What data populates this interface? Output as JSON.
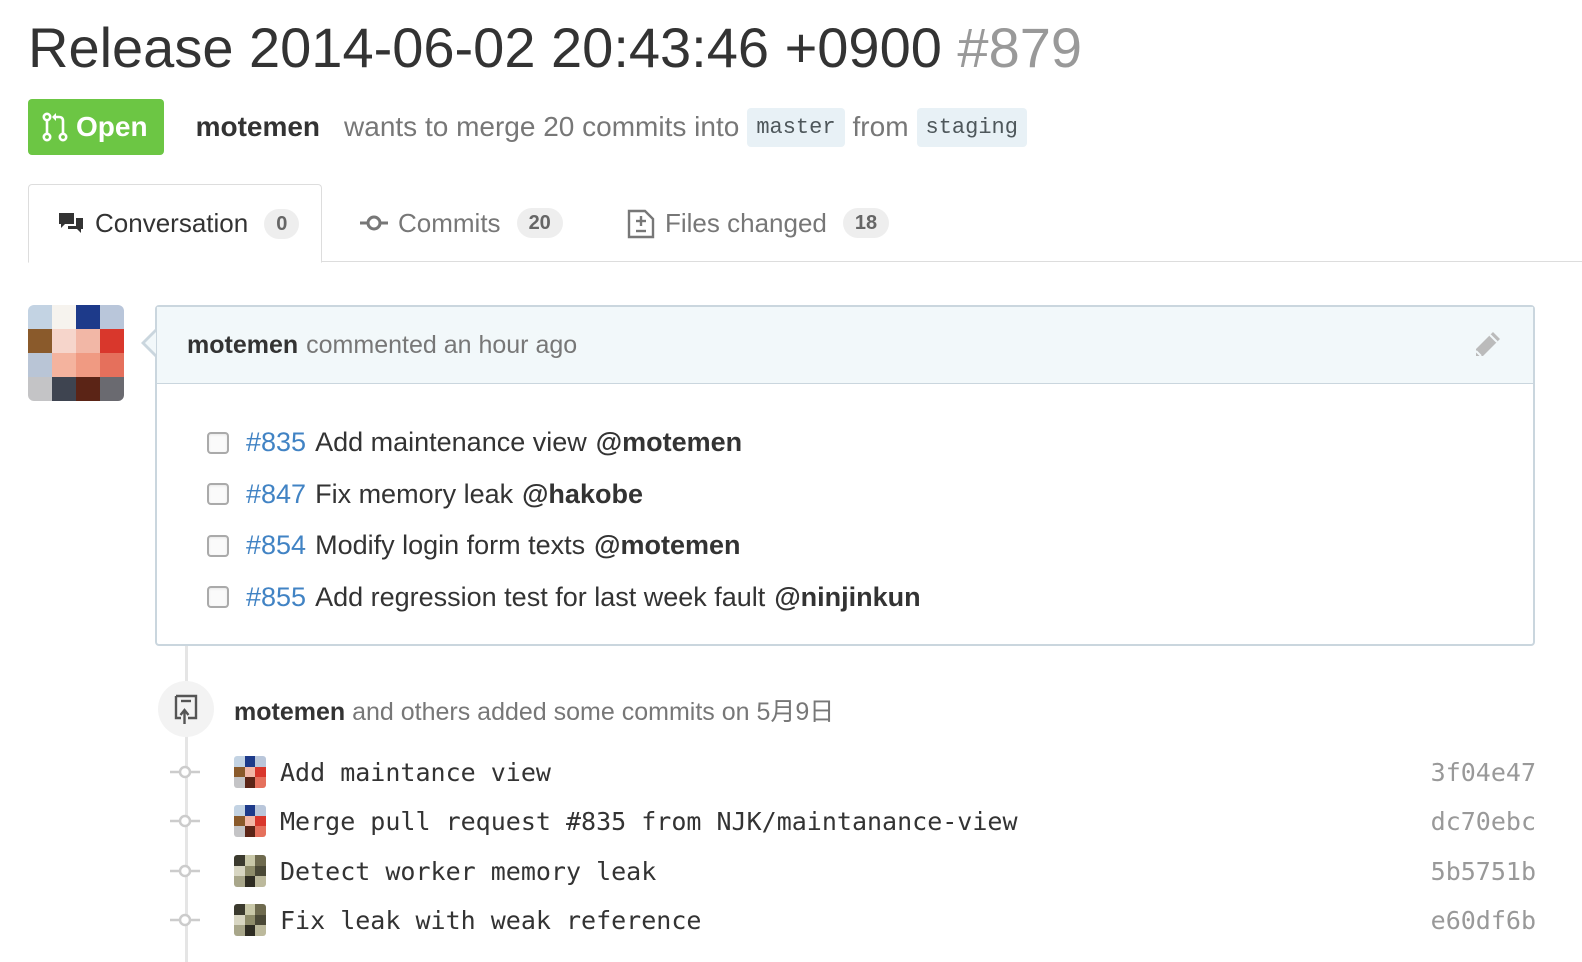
{
  "pull_request": {
    "title": "Release 2014-06-02 20:43:46 +0900",
    "number": "#879",
    "state": "Open",
    "author": "motemen",
    "merge_text": "wants to merge 20 commits into",
    "base_branch": "master",
    "from_text": "from",
    "head_branch": "staging"
  },
  "tabs": [
    {
      "label": "Conversation",
      "count": "0",
      "icon": "comment-discussion-icon",
      "selected": true
    },
    {
      "label": "Commits",
      "count": "20",
      "icon": "git-commit-icon",
      "selected": false
    },
    {
      "label": "Files changed",
      "count": "18",
      "icon": "file-diff-icon",
      "selected": false
    }
  ],
  "comment": {
    "author": "motemen",
    "action": "commented an hour ago",
    "tasks": [
      {
        "issue": "#835",
        "text": "Add maintenance view",
        "mention": "@motemen",
        "checked": false
      },
      {
        "issue": "#847",
        "text": "Fix memory leak",
        "mention": "@hakobe",
        "checked": false
      },
      {
        "issue": "#854",
        "text": "Modify login form texts",
        "mention": "@motemen",
        "checked": false
      },
      {
        "issue": "#855",
        "text": "Add regression test for last week fault",
        "mention": "@ninjinkun",
        "checked": false
      }
    ]
  },
  "commit_event": {
    "author": "motemen",
    "text": "and others added some commits on 5月9日",
    "icon": "repo-push-icon"
  },
  "commits": [
    {
      "message": "Add maintance view",
      "sha": "3f04e47",
      "avatar": "motemen"
    },
    {
      "message": "Merge pull request #835 from NJK/maintanance-view",
      "sha": "dc70ebc",
      "avatar": "motemen"
    },
    {
      "message": "Detect worker memory leak",
      "sha": "5b5751b",
      "avatar": "hakobe"
    },
    {
      "message": "Fix leak with weak reference",
      "sha": "e60df6b",
      "avatar": "hakobe"
    }
  ],
  "colors": {
    "open_green": "#6cc644",
    "link_blue": "#4183c4",
    "branch_bg": "#e8f1f6",
    "comment_header_bg": "#f2f8fa"
  }
}
